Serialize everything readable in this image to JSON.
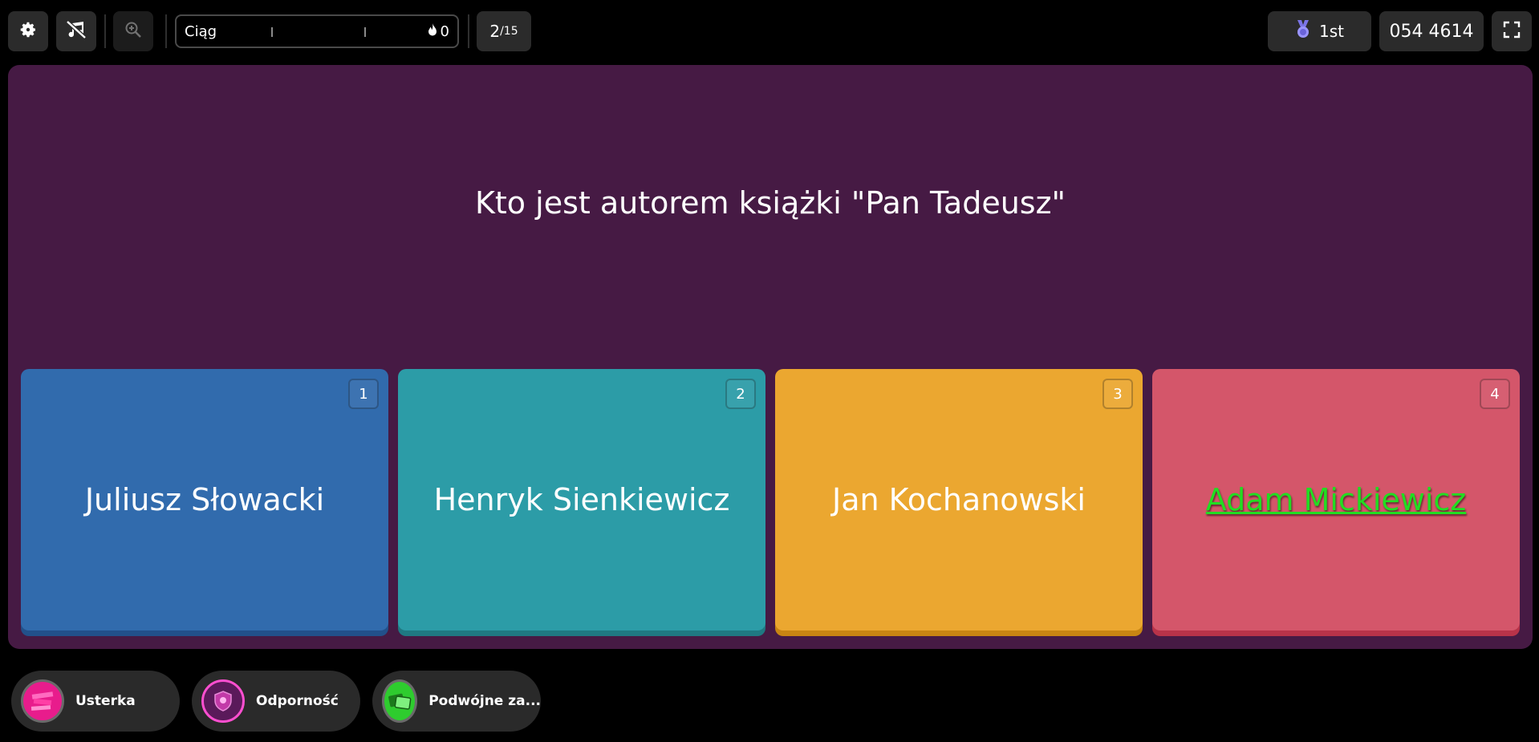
{
  "topbar": {
    "streak_label": "Ciąg",
    "streak_value": "0",
    "question_counter": {
      "current": "2",
      "total": "/15"
    },
    "rank": "1st",
    "game_code": "054 4614"
  },
  "question": {
    "text": "Kto jest autorem książki \"Pan Tadeusz\""
  },
  "answers": [
    {
      "number": "1",
      "text": "Juliusz Słowacki",
      "color": "#316bad"
    },
    {
      "number": "2",
      "text": "Henryk Sienkiewicz",
      "color": "#2c9ca7"
    },
    {
      "number": "3",
      "text": "Jan Kochanowski",
      "color": "#eba730"
    },
    {
      "number": "4",
      "text": "Adam Mickiewicz",
      "color": "#d4566a"
    }
  ],
  "powerups": [
    {
      "label": "Usterka",
      "icon": "glitch-icon",
      "color": "#e81c8c"
    },
    {
      "label": "Odporność",
      "icon": "shield-icon",
      "color": "#c23aa8"
    },
    {
      "label": "Podwójne za...",
      "icon": "double-points-icon",
      "color": "#2ecc2e"
    }
  ]
}
